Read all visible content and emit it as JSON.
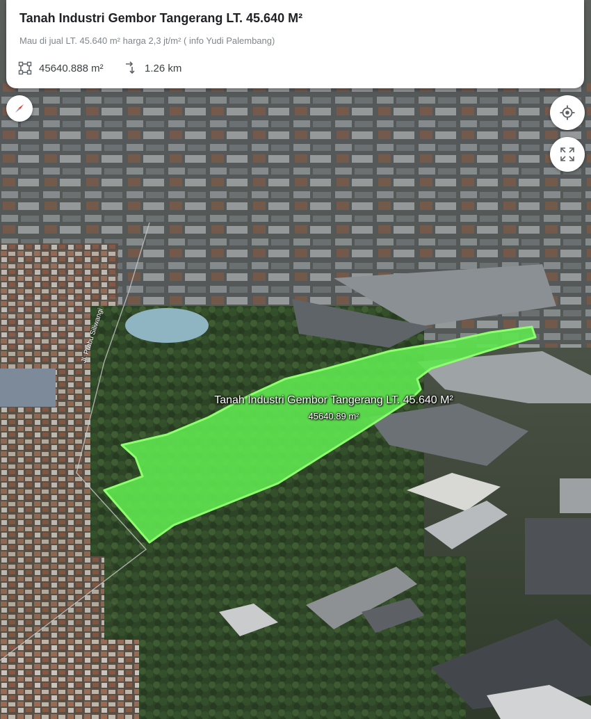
{
  "card": {
    "title": "Tanah Industri Gembor Tangerang  LT. 45.640 M²",
    "description": "Mau di jual LT. 45.640 m²  harga 2,3 jt/m²  ( info Yudi Palembang)",
    "area_value": "45640.888 m²",
    "perimeter_value": "1.26 km",
    "area_icon": "area-square-icon",
    "perimeter_icon": "perimeter-arrows-icon"
  },
  "map": {
    "parcel_label": "Tanah Industri Gembor Tangerang  LT. 45.640 M²",
    "parcel_area_label": "45640.89 m²",
    "road_label": "Jl. Prabu Siliwangi",
    "parcel_color": "#5ee34f",
    "parcel_outline": "#8dff6e"
  },
  "controls": {
    "compass_icon": "compass-icon",
    "locate_icon": "my-location-icon",
    "fullscreen_icon": "fullscreen-icon"
  }
}
